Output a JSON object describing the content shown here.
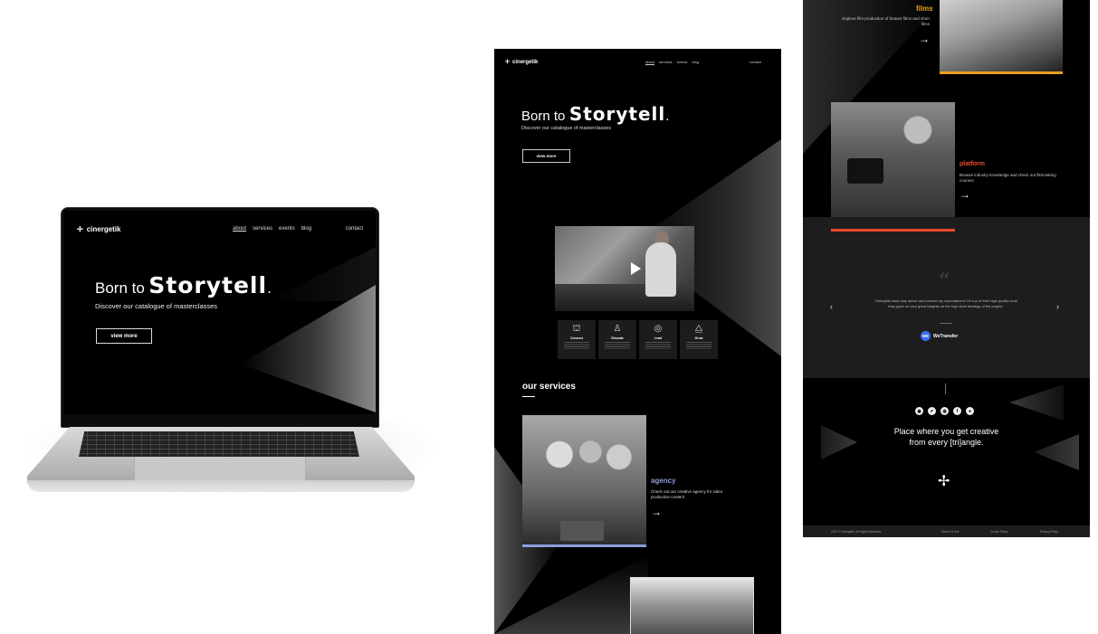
{
  "brand": {
    "name": "cinergetik",
    "logo_glyph": "✢"
  },
  "nav": {
    "items": [
      "about",
      "services",
      "events",
      "blog"
    ],
    "active": "about",
    "contact": "contact"
  },
  "hero": {
    "title_prefix": "Born to",
    "title_main": "Storytell",
    "title_suffix": ".",
    "subtitle": "Discover our catalogue of masterclasses",
    "cta": "view more"
  },
  "video": {
    "play_icon": "play-icon"
  },
  "features": [
    {
      "icon": "⛫",
      "label": "Connect"
    },
    {
      "icon": "♙",
      "label": "Educate"
    },
    {
      "icon": "◎",
      "label": "Lead"
    },
    {
      "icon": "⧋",
      "label": "Grow"
    }
  ],
  "services": {
    "heading": "our services",
    "agency": {
      "title": "agency",
      "description": "Check out our creative agency for video production content",
      "arrow": "→",
      "color": "#8b9fd9"
    },
    "films": {
      "title": "films",
      "description": "Explore film production of feature films and short films",
      "arrow": "→",
      "color": "#e8a01a"
    },
    "platform": {
      "title": "platform",
      "description": "Browse industry knowledge and check out filmmaking courses",
      "arrow": "→",
      "color": "#e84a2a"
    }
  },
  "testimonial": {
    "quote_mark": "“",
    "text": "Cinergetik went way above and exceed my expectations! On top of their high quality work they gave us very great insights on the high level strategy of the project.",
    "company": "WeTransfer",
    "company_badge": "we",
    "prev": "‹",
    "next": "›"
  },
  "footer": {
    "socials": [
      "◉",
      "✔",
      "◍",
      "f",
      "●"
    ],
    "tagline_line1": "Place where you get creative",
    "tagline_line2": "from every [tri]angle.",
    "copyright": "2023 © Cinergetik. All Rights Reserved.",
    "links": [
      "Terms Of Use",
      "Cookie Policy",
      "Privacy Policy"
    ]
  }
}
